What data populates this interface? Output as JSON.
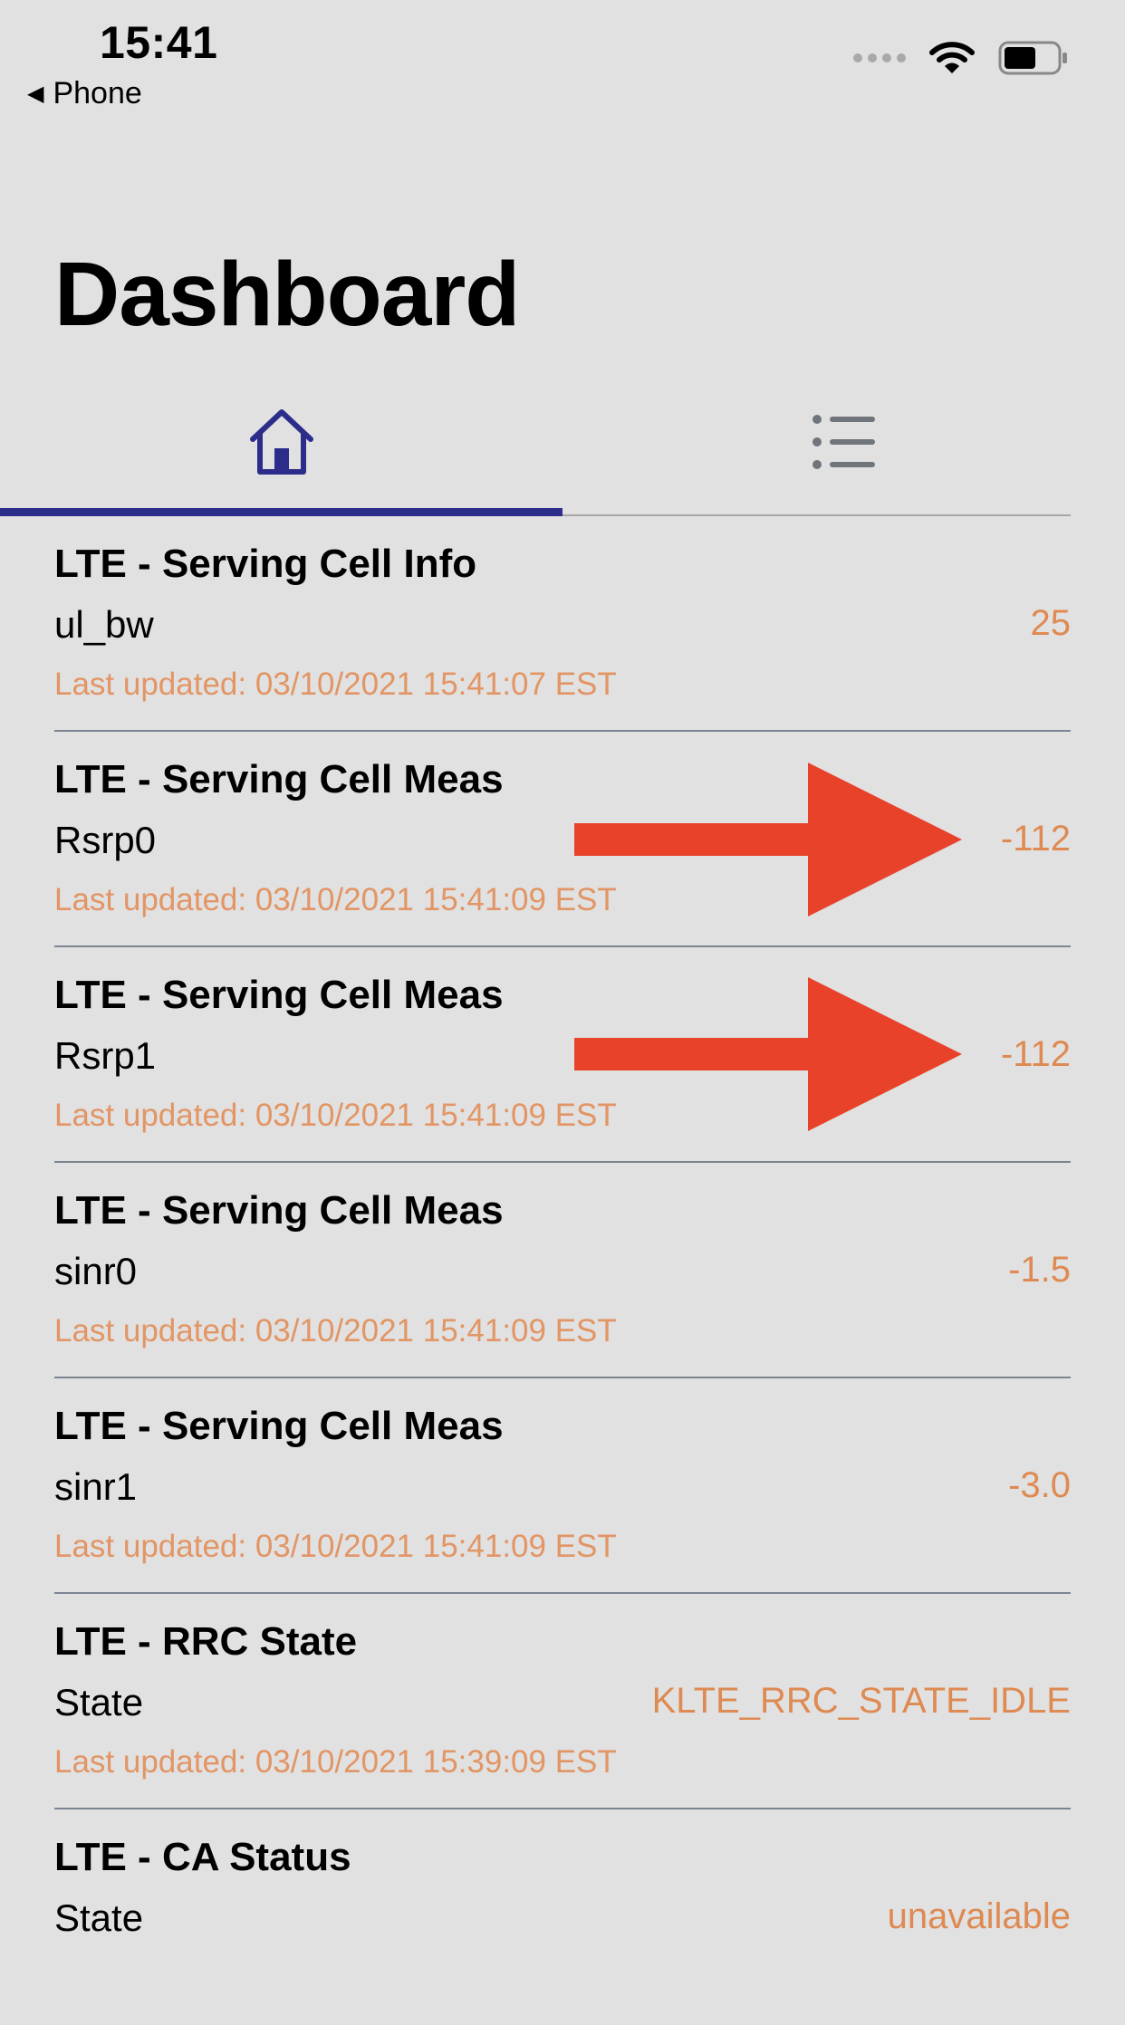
{
  "status_bar": {
    "time": "15:41",
    "back_label": "Phone",
    "icons": [
      "back-triangle-icon",
      "signal-dots-icon",
      "wifi-icon",
      "battery-icon"
    ]
  },
  "title": "Dashboard",
  "tabs": [
    {
      "icon": "home-icon",
      "selected": true
    },
    {
      "icon": "list-icon",
      "selected": false
    }
  ],
  "colors": {
    "accent": "#2c2d8b",
    "value_orange": "#de8a52",
    "arrow_red": "#e8432a",
    "background": "#e1e1e1"
  },
  "cards": [
    {
      "title": "LTE - Serving Cell Info",
      "label": "ul_bw",
      "value": "25",
      "updated": "Last updated: 03/10/2021 15:41:07 EST"
    },
    {
      "title": "LTE - Serving Cell Meas",
      "label": "Rsrp0",
      "value": "-112",
      "updated": "Last updated: 03/10/2021 15:41:09 EST",
      "annotated": true
    },
    {
      "title": "LTE - Serving Cell Meas",
      "label": "Rsrp1",
      "value": "-112",
      "updated": "Last updated: 03/10/2021 15:41:09 EST",
      "annotated": true
    },
    {
      "title": "LTE - Serving Cell Meas",
      "label": "sinr0",
      "value": "-1.5",
      "updated": "Last updated: 03/10/2021 15:41:09 EST"
    },
    {
      "title": "LTE - Serving Cell Meas",
      "label": "sinr1",
      "value": "-3.0",
      "updated": "Last updated: 03/10/2021 15:41:09 EST"
    },
    {
      "title": "LTE - RRC State",
      "label": "State",
      "value": "KLTE_RRC_STATE_IDLE",
      "updated": "Last updated: 03/10/2021 15:39:09 EST"
    },
    {
      "title": "LTE - CA Status",
      "label": "State",
      "value": "unavailable",
      "updated": ""
    }
  ]
}
